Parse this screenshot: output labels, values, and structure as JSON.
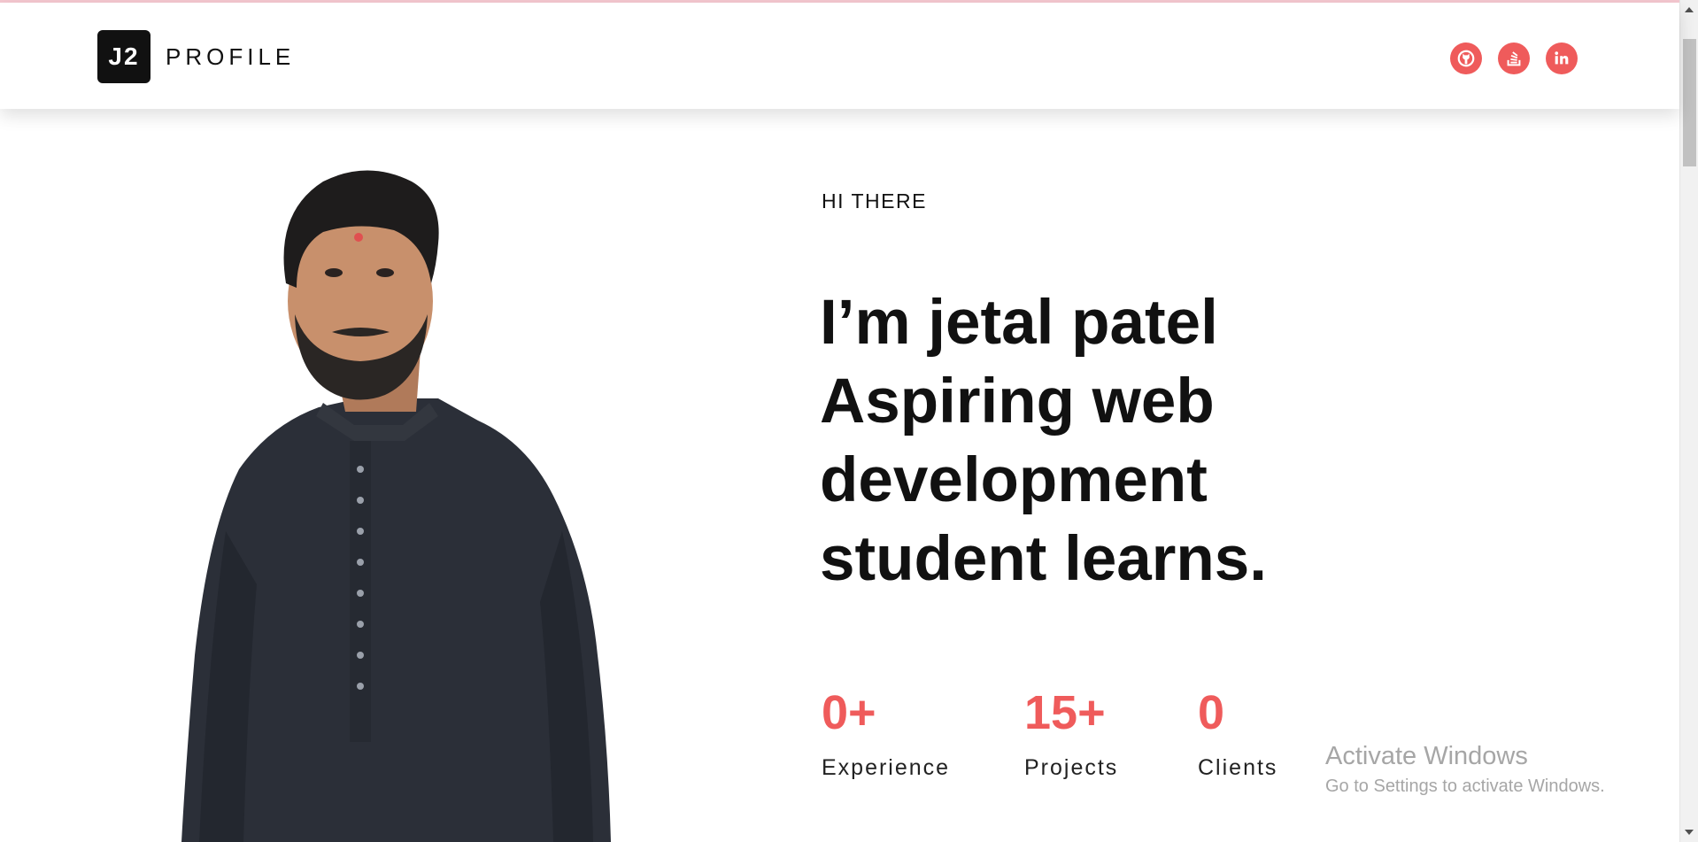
{
  "header": {
    "logo_mark": "J2",
    "logo_text": "PROFILE",
    "social_links": [
      {
        "name": "github",
        "icon": "github-icon"
      },
      {
        "name": "stack-overflow",
        "icon": "stack-overflow-icon"
      },
      {
        "name": "linkedin",
        "icon": "linkedin-icon"
      }
    ]
  },
  "hero": {
    "eyebrow": "HI THERE",
    "headline_lines": [
      "I’m jetal patel",
      "Aspiring web",
      "development",
      "student learns."
    ],
    "stats": [
      {
        "value": "0+",
        "label": "Experience"
      },
      {
        "value": "15+",
        "label": "Projects"
      },
      {
        "value": "0",
        "label": "Clients"
      }
    ]
  },
  "watermark": {
    "title": "Activate Windows",
    "subtitle": "Go to Settings to activate Windows."
  },
  "colors": {
    "accent": "#ef5b5b",
    "text": "#111111",
    "logo_bg": "#111111"
  }
}
